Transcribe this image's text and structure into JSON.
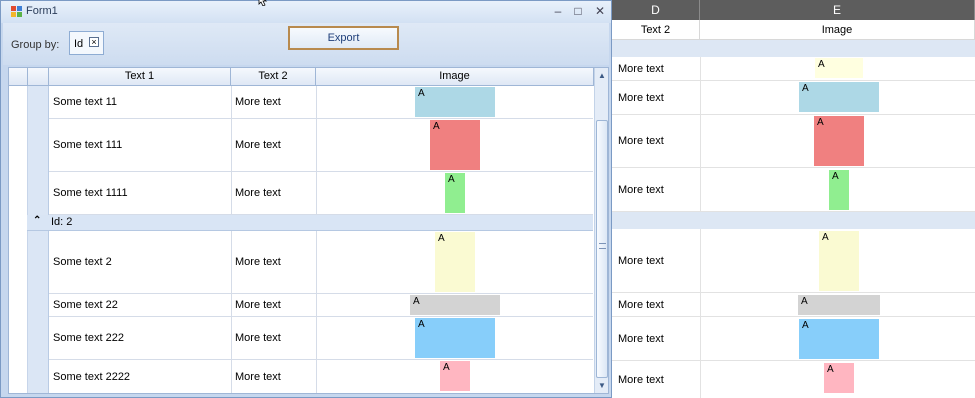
{
  "window": {
    "title": "Form1"
  },
  "toolbar": {
    "group_by_label": "Group by:",
    "group_chip": "Id",
    "export_label": "Export"
  },
  "grid": {
    "columns": [
      "Text 1",
      "Text 2",
      "Image"
    ],
    "group_label": "Id: 2",
    "rows": [
      {
        "text1": "Some text 11",
        "text2": "More text",
        "image_letter": "A",
        "color": "#add8e6"
      },
      {
        "text1": "Some text 111",
        "text2": "More text",
        "image_letter": "A",
        "color": "#f08080"
      },
      {
        "text1": "Some text 1111",
        "text2": "More text",
        "image_letter": "A",
        "color": "#90ee90"
      },
      {
        "text1": "Some text 2",
        "text2": "More text",
        "image_letter": "A",
        "color": "#fafad2"
      },
      {
        "text1": "Some text 22",
        "text2": "More text",
        "image_letter": "A",
        "color": "#d3d3d3"
      },
      {
        "text1": "Some text 222",
        "text2": "More text",
        "image_letter": "A",
        "color": "#87cefa"
      },
      {
        "text1": "Some text 2222",
        "text2": "More text",
        "image_letter": "A",
        "color": "#ffb6c1"
      }
    ]
  },
  "excel": {
    "col_d": "D",
    "col_e": "E",
    "hdr_d": "Text 2",
    "hdr_e": "Image",
    "rows": [
      {
        "text2": "More text",
        "image_letter": "A",
        "color": "#ffffe0"
      },
      {
        "text2": "More text",
        "image_letter": "A",
        "color": "#add8e6"
      },
      {
        "text2": "More text",
        "image_letter": "A",
        "color": "#f08080"
      },
      {
        "text2": "More text",
        "image_letter": "A",
        "color": "#90ee90"
      },
      {
        "text2": "More text",
        "image_letter": "A",
        "color": "#fafad2"
      },
      {
        "text2": "More text",
        "image_letter": "A",
        "color": "#d3d3d3"
      },
      {
        "text2": "More text",
        "image_letter": "A",
        "color": "#87cefa"
      },
      {
        "text2": "More text",
        "image_letter": "A",
        "color": "#ffb6c1"
      }
    ]
  },
  "icons": {
    "minimize": "minimize-icon",
    "maximize": "maximize-icon",
    "close": "close-icon"
  }
}
